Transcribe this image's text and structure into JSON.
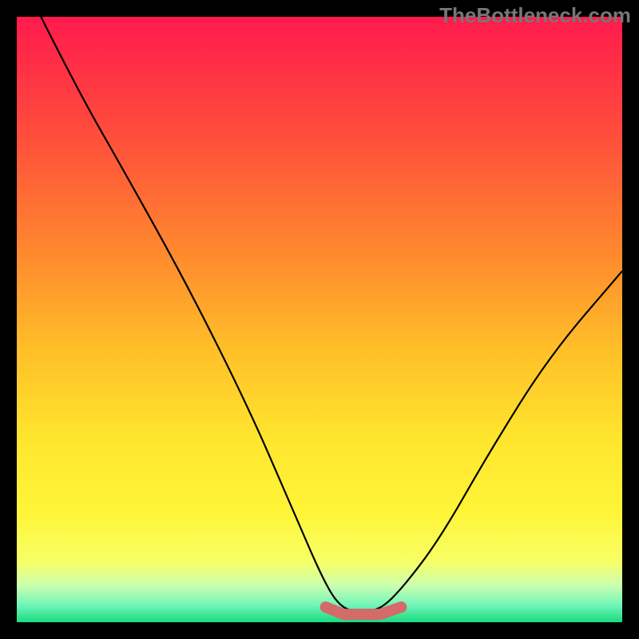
{
  "watermark": "TheBottleneck.com",
  "chart_data": {
    "type": "line",
    "title": "",
    "xlabel": "",
    "ylabel": "",
    "xlim": [
      0,
      100
    ],
    "ylim": [
      0,
      100
    ],
    "series": [
      {
        "name": "curve",
        "color": "#000000",
        "x": [
          4,
          10,
          18,
          28,
          38,
          45,
          51,
          54,
          57,
          60,
          64,
          70,
          78,
          88,
          100
        ],
        "y": [
          100,
          88,
          74,
          56,
          36,
          20,
          6,
          2,
          2,
          2,
          6,
          14,
          28,
          44,
          58
        ]
      },
      {
        "name": "bottom-marker",
        "color": "#d46a6a",
        "x": [
          51,
          54,
          57,
          60,
          63.5
        ],
        "y": [
          2.5,
          1.3,
          1.3,
          1.3,
          2.5
        ]
      }
    ],
    "background_gradient": {
      "stops": [
        {
          "offset": 0.0,
          "color": "#ff1a4d"
        },
        {
          "offset": 0.2,
          "color": "#ff4f3b"
        },
        {
          "offset": 0.4,
          "color": "#ff8c2e"
        },
        {
          "offset": 0.55,
          "color": "#ffbf28"
        },
        {
          "offset": 0.7,
          "color": "#ffe62e"
        },
        {
          "offset": 0.82,
          "color": "#fff538"
        },
        {
          "offset": 0.9,
          "color": "#f7ff66"
        },
        {
          "offset": 0.94,
          "color": "#c9ffb0"
        },
        {
          "offset": 0.972,
          "color": "#70f5b8"
        },
        {
          "offset": 1.0,
          "color": "#19db7e"
        }
      ]
    }
  }
}
